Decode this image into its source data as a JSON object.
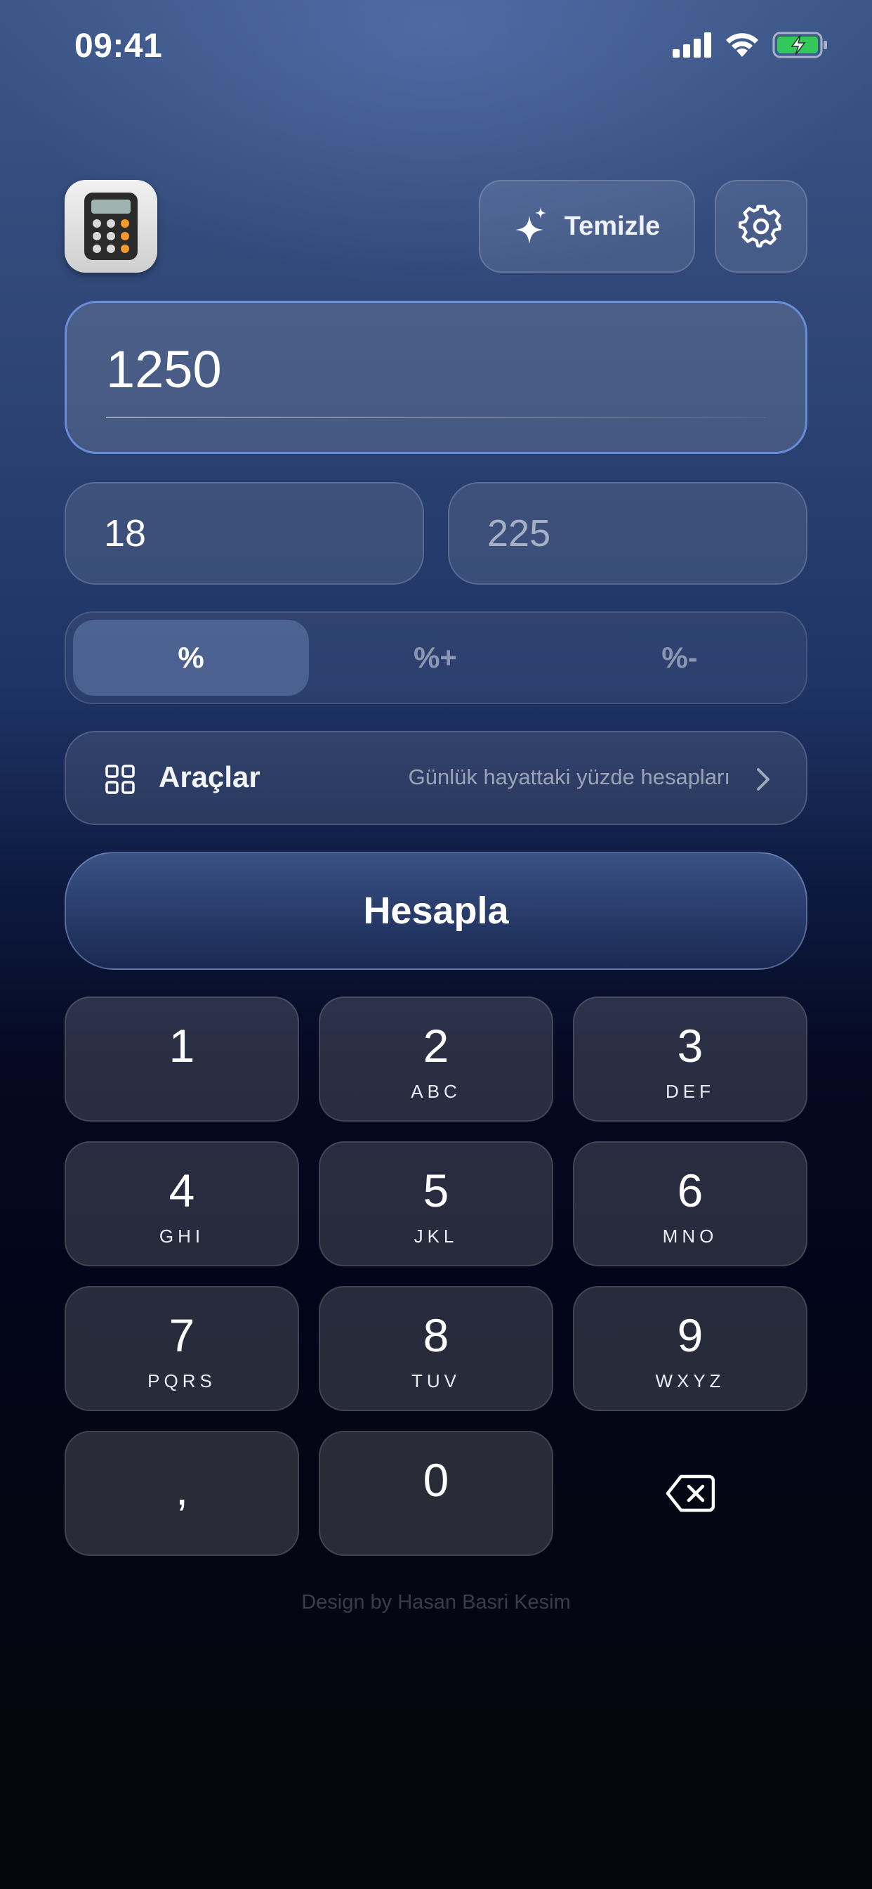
{
  "status_bar": {
    "time": "09:41",
    "icons": [
      "cellular-signal-icon",
      "wifi-icon",
      "battery-charging-icon"
    ]
  },
  "header": {
    "app_icon": "calculator-icon",
    "clear_label": "Temizle",
    "clear_icon": "sparkles-icon",
    "settings_icon": "gear-icon"
  },
  "inputs": {
    "main_value": "1250",
    "rate_value": "18",
    "result_placeholder": "225"
  },
  "modes": {
    "items": [
      "%",
      "%+",
      "%-"
    ],
    "selected": "%"
  },
  "tools": {
    "icon": "grid-icon",
    "label": "Araçlar",
    "description": "Günlük hayattaki yüzde hesapları",
    "chevron": "chevron-right-icon"
  },
  "calculate_label": "Hesapla",
  "keypad": {
    "keys": [
      {
        "num": "1",
        "letters": ""
      },
      {
        "num": "2",
        "letters": "ABC"
      },
      {
        "num": "3",
        "letters": "DEF"
      },
      {
        "num": "4",
        "letters": "GHI"
      },
      {
        "num": "5",
        "letters": "JKL"
      },
      {
        "num": "6",
        "letters": "MNO"
      },
      {
        "num": "7",
        "letters": "PQRS"
      },
      {
        "num": "8",
        "letters": "TUV"
      },
      {
        "num": "9",
        "letters": "WXYZ"
      },
      {
        "num": ",",
        "letters": ""
      },
      {
        "num": "0",
        "letters": ""
      }
    ],
    "backspace_icon": "backspace-icon"
  },
  "footer": "Design by Hasan Basri Kesim",
  "colors": {
    "accent_border": "#6e96e6",
    "battery_green": "#34c759"
  }
}
